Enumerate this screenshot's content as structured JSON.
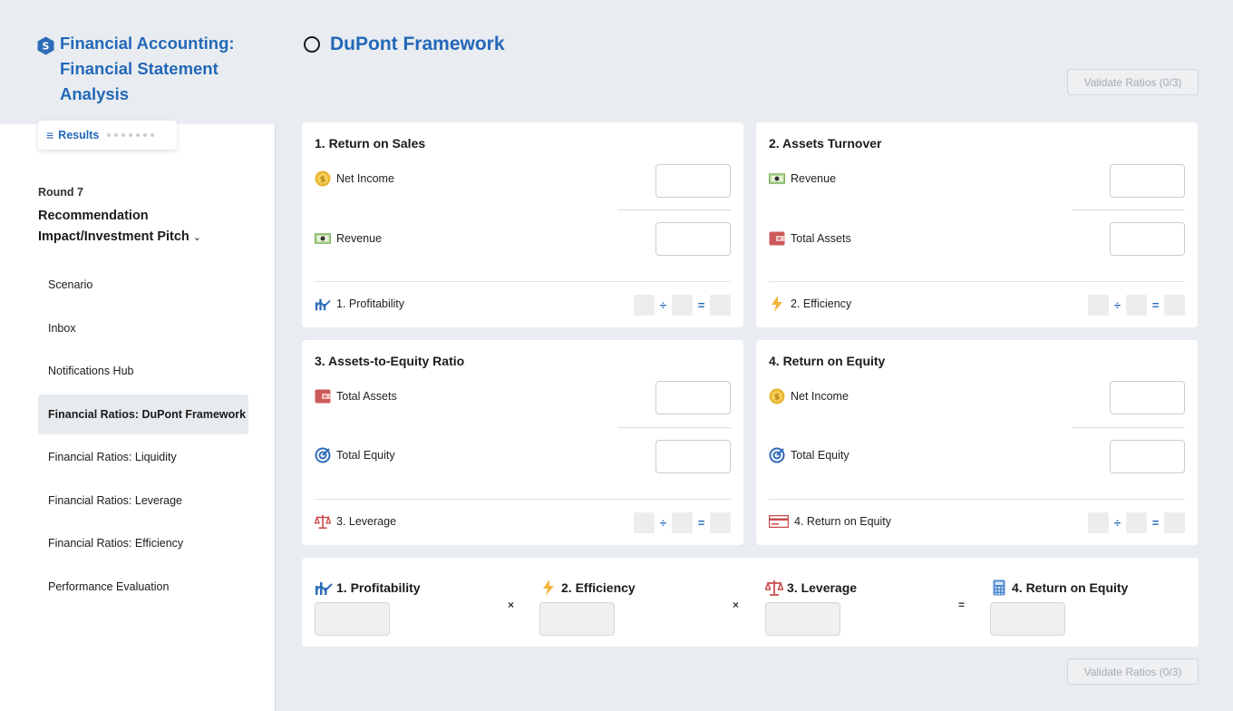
{
  "sidebar": {
    "title": "Financial Accounting: Financial Statement Analysis",
    "results_label": "Results",
    "round_label": "Round 7",
    "round_title": "Recommendation Impact/Investment Pitch",
    "nav": [
      {
        "label": "Scenario"
      },
      {
        "label": "Inbox"
      },
      {
        "label": "Notifications Hub"
      },
      {
        "label": "Financial Ratios: DuPont Framework",
        "active": true
      },
      {
        "label": "Financial Ratios: Liquidity"
      },
      {
        "label": "Financial Ratios: Leverage"
      },
      {
        "label": "Financial Ratios: Efficiency"
      },
      {
        "label": "Performance Evaluation"
      }
    ]
  },
  "main": {
    "title": "DuPont Framework",
    "validate_label": "Validate Ratios (0/3)",
    "cards": [
      {
        "title": "1. Return on Sales",
        "numerator": "Net Income",
        "denominator": "Revenue",
        "result": "1. Profitability",
        "num_icon": "coin-icon",
        "den_icon": "cash-icon",
        "res_icon": "chart-icon"
      },
      {
        "title": "2. Assets Turnover",
        "numerator": "Revenue",
        "denominator": "Total Assets",
        "result": "2. Efficiency",
        "num_icon": "cash-icon",
        "den_icon": "wallet-icon",
        "res_icon": "lightning-icon"
      },
      {
        "title": "3. Assets-to-Equity Ratio",
        "numerator": "Total Assets",
        "denominator": "Total Equity",
        "result": "3. Leverage",
        "num_icon": "wallet-icon",
        "den_icon": "target-icon",
        "res_icon": "scale-icon"
      },
      {
        "title": "4. Return on Equity",
        "numerator": "Net Income",
        "denominator": "Total Equity",
        "result": "4. Return on Equity",
        "num_icon": "coin-icon",
        "den_icon": "target-icon",
        "res_icon": "card-icon"
      }
    ],
    "operators": {
      "divide": "÷",
      "equals": "=",
      "times": "×"
    },
    "summary": [
      {
        "label": "1. Profitability",
        "icon": "chart-icon"
      },
      {
        "label": "2. Efficiency",
        "icon": "lightning-icon"
      },
      {
        "label": "3. Leverage",
        "icon": "scale-icon"
      },
      {
        "label": "4. Return on Equity",
        "icon": "calculator-icon"
      }
    ]
  },
  "colors": {
    "accent": "#2368b8",
    "background": "#e9edf1"
  }
}
